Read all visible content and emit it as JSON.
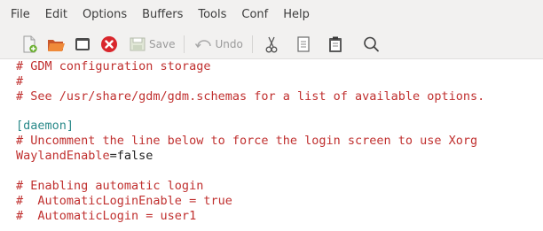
{
  "menu": [
    "File",
    "Edit",
    "Options",
    "Buffers",
    "Tools",
    "Conf",
    "Help"
  ],
  "toolbar": {
    "save_label": "Save",
    "undo_label": "Undo"
  },
  "editor_lines": {
    "l1": "# GDM configuration storage",
    "l2": "#",
    "l3": "# See /usr/share/gdm/gdm.schemas for a list of available options.",
    "l5": "[daemon]",
    "l6": "# Uncomment the line below to force the login screen to use Xorg",
    "l7_key": "WaylandEnable",
    "l7_value": "=false",
    "l9": "# Enabling automatic login",
    "l10": "#  AutomaticLoginEnable = true",
    "l11": "#  AutomaticLogin = user1"
  },
  "colors": {
    "comment": "#c0302f",
    "section": "#2a8a8a",
    "text": "#222222",
    "chrome": "#f2f1f0"
  }
}
